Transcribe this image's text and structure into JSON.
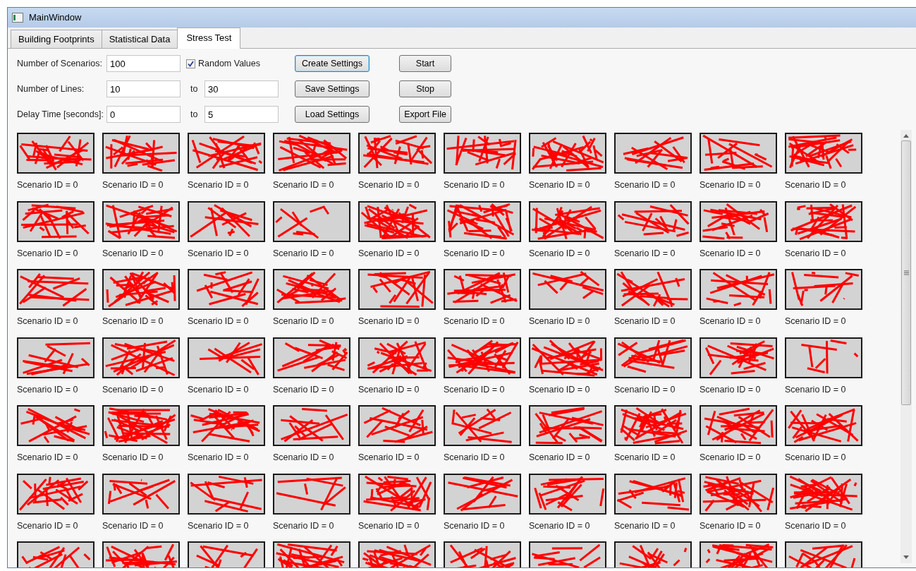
{
  "window": {
    "title": "MainWindow"
  },
  "tabs": [
    {
      "label": "Building Footprints",
      "selected": false
    },
    {
      "label": "Statistical Data",
      "selected": false
    },
    {
      "label": "Stress Test",
      "selected": true
    }
  ],
  "settings": {
    "scenarios": {
      "label": "Number of Scenarios:",
      "value": "100"
    },
    "random_values": {
      "label": "Random Values",
      "checked": true
    },
    "lines": {
      "label": "Number of Lines:",
      "from": "10",
      "to_label": "to",
      "to": "30"
    },
    "delay": {
      "label": "Delay Time [seconds]:",
      "from": "0",
      "to_label": "to",
      "to": "5"
    }
  },
  "settings_buttons": [
    {
      "label": "Create Settings",
      "focused": true
    },
    {
      "label": "Save Settings",
      "focused": false
    },
    {
      "label": "Load Settings",
      "focused": false
    }
  ],
  "run_buttons": [
    {
      "label": "Start"
    },
    {
      "label": "Stop"
    },
    {
      "label": "Export File"
    }
  ],
  "scenario_rows": [
    {
      "captions": [
        "Scenario ID = 0",
        "Scenario ID = 0",
        "Scenario ID = 0",
        "Scenario ID = 0",
        "Scenario ID = 0",
        "Scenario ID = 0",
        "Scenario ID = 0",
        "Scenario ID = 0",
        "Scenario ID = 0",
        "Scenario ID = 0"
      ]
    },
    {
      "captions": [
        "Scenario ID = 0",
        "Scenario ID = 0",
        "Scenario ID = 0",
        "Scenario ID = 0",
        "Scenario ID = 0",
        "Scenario ID = 0",
        "Scenario ID = 0",
        "Scenario ID = 0",
        "Scenario ID = 0",
        "Scenario ID = 0"
      ]
    },
    {
      "captions": [
        "Scenario ID = 0",
        "Scenario ID = 0",
        "Scenario ID = 0",
        "Scenario ID = 0",
        "Scenario ID = 0",
        "Scenario ID = 0",
        "Scenario ID = 0",
        "Scenario ID = 0",
        "Scenario ID = 0",
        "Scenario ID = 0"
      ]
    },
    {
      "captions": [
        "Scenario ID = 0",
        "Scenario ID = 0",
        "Scenario ID = 0",
        "Scenario ID = 0",
        "Scenario ID = 0",
        "Scenario ID = 0",
        "Scenario ID = 0",
        "Scenario ID = 0",
        "Scenario ID = 0",
        "Scenario ID = 0"
      ]
    },
    {
      "captions": [
        "Scenario ID = 0",
        "Scenario ID = 0",
        "Scenario ID = 0",
        "Scenario ID = 0",
        "Scenario ID = 0",
        "Scenario ID = 0",
        "Scenario ID = 0",
        "Scenario ID = 0",
        "Scenario ID = 0",
        "Scenario ID = 0"
      ]
    },
    {
      "captions": [
        "Scenario ID = 0",
        "Scenario ID = 0",
        "Scenario ID = 0",
        "Scenario ID = 0",
        "Scenario ID = 0",
        "Scenario ID = 0",
        "Scenario ID = 0",
        "Scenario ID = 0",
        "Scenario ID = 0",
        "Scenario ID = 0"
      ]
    },
    {
      "captions_hidden": true
    }
  ]
}
